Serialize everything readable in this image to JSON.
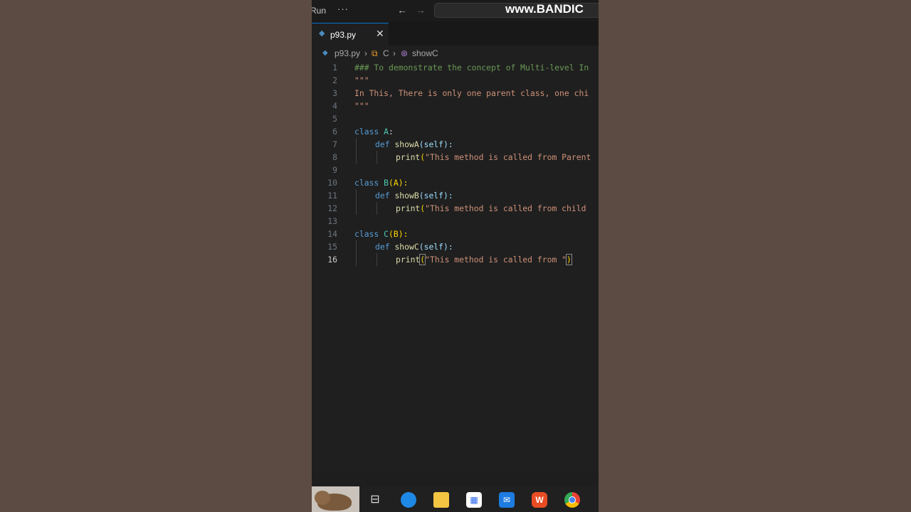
{
  "titlebar": {
    "menu_run": "Run",
    "more": "···",
    "nav_back": "←",
    "nav_forward": "→",
    "watermark": "www.BANDIC"
  },
  "tab": {
    "label": "p93.py",
    "close": "✕",
    "icon": "python-file-icon"
  },
  "breadcrumb": {
    "file": "p93.py",
    "sep1": "›",
    "class": "C",
    "sep2": "›",
    "method": "showC",
    "class_icon": "⧉",
    "method_icon": "⊛"
  },
  "editor": {
    "active_line": 16,
    "lines": [
      {
        "n": "1",
        "t": "### To demonstrate the concept of Multi-level In"
      },
      {
        "n": "2",
        "t": "\"\"\""
      },
      {
        "n": "3",
        "t": "In This, There is only one parent class, one chi"
      },
      {
        "n": "4",
        "t": "\"\"\""
      },
      {
        "n": "5",
        "t": ""
      },
      {
        "n": "6",
        "kw": "class",
        "name": "A",
        "tail": ":"
      },
      {
        "n": "7",
        "kw": "def",
        "name": "showA",
        "tail": "(self):"
      },
      {
        "n": "8",
        "fn": "print",
        "str": "\"This method is called from Parent"
      },
      {
        "n": "9",
        "t": ""
      },
      {
        "n": "10",
        "kw": "class",
        "name": "B",
        "tail": "(A):"
      },
      {
        "n": "11",
        "kw": "def",
        "name": "showB",
        "tail": "(self):"
      },
      {
        "n": "12",
        "fn": "print",
        "str": "\"This method is called from child"
      },
      {
        "n": "13",
        "t": ""
      },
      {
        "n": "14",
        "kw": "class",
        "name": "C",
        "tail": "(B):"
      },
      {
        "n": "15",
        "kw": "def",
        "name": "showC",
        "tail": "(self):"
      },
      {
        "n": "16",
        "fn": "print",
        "str": "\"This method is called from \"",
        "close": ")"
      }
    ]
  },
  "taskbar": {
    "thumbnail": "wombat-thumbnail",
    "icons": [
      "task-view-icon",
      "edge-icon",
      "file-explorer-icon",
      "store-icon",
      "mail-icon",
      "office-icon",
      "chrome-icon"
    ],
    "task_view_glyph": "⊟",
    "office_glyph": "W"
  },
  "colors": {
    "comment": "#6a9955",
    "string": "#ce9178",
    "keyword": "#569cd6",
    "class_name": "#4ec9b0",
    "function": "#dcdcaa",
    "tab_accent": "#0078d4"
  }
}
